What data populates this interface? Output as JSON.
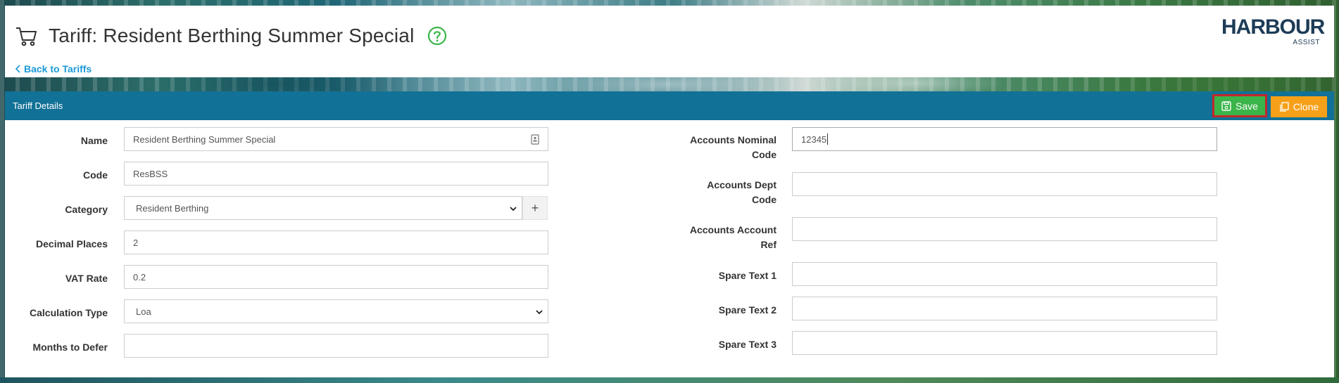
{
  "header": {
    "title": "Tariff: Resident Berthing Summer Special",
    "back_link": "Back to Tariffs",
    "logo_main": "HARBOUR",
    "logo_sub": "ASSIST"
  },
  "panel": {
    "title": "Tariff Details",
    "save_label": "Save",
    "clone_label": "Clone"
  },
  "left_fields": {
    "name": {
      "label": "Name",
      "value": "Resident Berthing Summer Special"
    },
    "code": {
      "label": "Code",
      "value": "ResBSS"
    },
    "category": {
      "label": "Category",
      "value": "Resident Berthing",
      "plus": "+"
    },
    "decimal_places": {
      "label": "Decimal Places",
      "value": "2"
    },
    "vat_rate": {
      "label": "VAT Rate",
      "value": "0.2"
    },
    "calculation_type": {
      "label": "Calculation Type",
      "value": "Loa"
    },
    "months_to_defer": {
      "label": "Months to Defer",
      "value": ""
    }
  },
  "right_fields": {
    "accounts_nominal_code": {
      "label_line1": "Accounts Nominal",
      "label_line2": "Code",
      "value": "12345"
    },
    "accounts_dept_code": {
      "label_line1": "Accounts Dept",
      "label_line2": "Code",
      "value": ""
    },
    "accounts_account_ref": {
      "label_line1": "Accounts Account",
      "label_line2": "Ref",
      "value": ""
    },
    "spare_text_1": {
      "label": "Spare Text 1",
      "value": ""
    },
    "spare_text_2": {
      "label": "Spare Text 2",
      "value": ""
    },
    "spare_text_3": {
      "label": "Spare Text 3",
      "value": ""
    }
  },
  "colors": {
    "panel_header": "#127196",
    "save_button": "#3bb54a",
    "save_highlight": "#c1272d",
    "clone_button": "#f6a01a",
    "link": "#1b9ad6",
    "help_icon": "#3bb54a"
  },
  "icons": [
    "cart-icon",
    "help-icon",
    "chevron-left-icon",
    "save-icon",
    "clone-icon",
    "contact-card-icon",
    "chevron-down-icon",
    "plus-icon"
  ]
}
